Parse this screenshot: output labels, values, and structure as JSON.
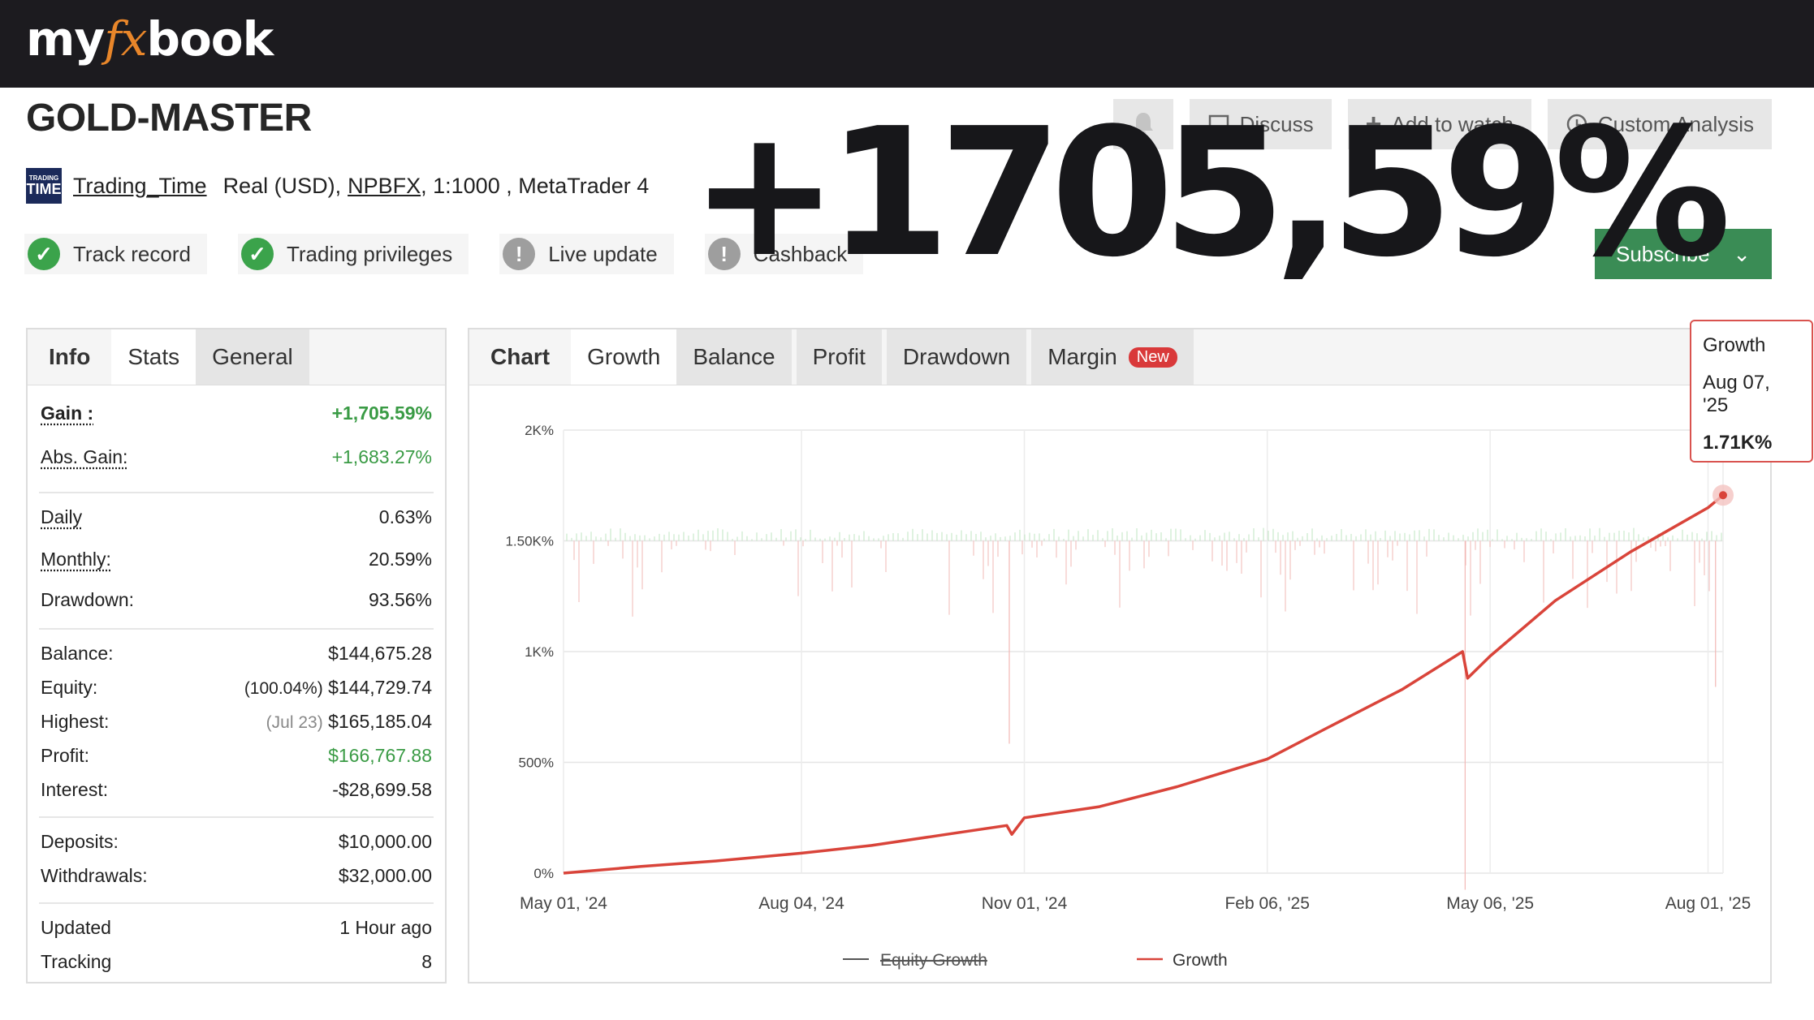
{
  "brand": {
    "logo_pre": "my",
    "logo_fx": "fx",
    "logo_post": "book"
  },
  "system": {
    "title": "GOLD-MASTER",
    "owner_logo_small": "TRADING",
    "owner_logo_big": "TIME",
    "owner": "Trading_Time",
    "account": "Real (USD),",
    "broker": "NPBFX",
    "leverage_platform": ", 1:1000 , MetaTrader 4"
  },
  "badges": [
    {
      "label": "Track record",
      "status": "ok"
    },
    {
      "label": "Trading privileges",
      "status": "ok"
    },
    {
      "label": "Live update",
      "status": "warn"
    },
    {
      "label": "Cashback",
      "status": "warn"
    }
  ],
  "actions": {
    "bell_icon": "bell-icon",
    "discuss": "Discuss",
    "watch": "Add to watch",
    "analysis": "Custom Analysis",
    "subscribe": "Subscribe"
  },
  "headline": "+1705,59%",
  "left_tabs": {
    "header": "Info",
    "stats": "Stats",
    "general": "General"
  },
  "stats": {
    "gain_label": "Gain :",
    "gain": "+1,705.59%",
    "abs_gain_label": "Abs. Gain:",
    "abs_gain": "+1,683.27%",
    "daily_label": "Daily",
    "daily": "0.63%",
    "monthly_label": "Monthly:",
    "monthly": "20.59%",
    "drawdown_label": "Drawdown:",
    "drawdown": "93.56%",
    "balance_label": "Balance:",
    "balance": "$144,675.28",
    "equity_label": "Equity:",
    "equity_pct": "(100.04%)",
    "equity": "$144,729.74",
    "highest_label": "Highest:",
    "highest_date": "(Jul 23)",
    "highest": "$165,185.04",
    "profit_label": "Profit:",
    "profit": "$166,767.88",
    "interest_label": "Interest:",
    "interest": "-$28,699.58",
    "deposits_label": "Deposits:",
    "deposits": "$10,000.00",
    "withdrawals_label": "Withdrawals:",
    "withdrawals": "$32,000.00",
    "updated_label": "Updated",
    "updated": "1 Hour ago",
    "tracking_label": "Tracking",
    "tracking": "8"
  },
  "chart_tabs": {
    "header": "Chart",
    "growth": "Growth",
    "balance": "Balance",
    "profit": "Profit",
    "drawdown": "Drawdown",
    "margin": "Margin",
    "new_badge": "New"
  },
  "tooltip": {
    "series": "Growth",
    "date": "Aug 07, '25",
    "value": "1.71K%"
  },
  "chart_data": {
    "type": "line",
    "x_axis_type": "date",
    "y_ticks": [
      "0%",
      "500%",
      "1K%",
      "1.50K%",
      "2K%"
    ],
    "ylim": [
      0,
      2000
    ],
    "x_ticks": [
      "May 01, '24",
      "Aug 04, '24",
      "Nov 01, '24",
      "Feb 06, '25",
      "May 06, '25",
      "Aug 01, '25"
    ],
    "legend": [
      {
        "name": "Equity Growth",
        "hidden": true,
        "color": "#555555"
      },
      {
        "name": "Growth",
        "hidden": false,
        "color": "#d9443a"
      }
    ],
    "grid": true,
    "series": [
      {
        "name": "Growth",
        "color": "#d9443a",
        "points": [
          [
            "2024-05-01",
            0
          ],
          [
            "2024-06-01",
            30
          ],
          [
            "2024-07-01",
            55
          ],
          [
            "2024-08-04",
            90
          ],
          [
            "2024-09-01",
            125
          ],
          [
            "2024-10-01",
            175
          ],
          [
            "2024-10-25",
            215
          ],
          [
            "2024-10-27",
            175
          ],
          [
            "2024-11-01",
            250
          ],
          [
            "2024-12-01",
            300
          ],
          [
            "2025-01-01",
            390
          ],
          [
            "2025-02-06",
            515
          ],
          [
            "2025-03-01",
            650
          ],
          [
            "2025-04-01",
            830
          ],
          [
            "2025-04-25",
            1000
          ],
          [
            "2025-04-27",
            880
          ],
          [
            "2025-05-06",
            980
          ],
          [
            "2025-06-01",
            1230
          ],
          [
            "2025-07-01",
            1450
          ],
          [
            "2025-08-01",
            1650
          ],
          [
            "2025-08-07",
            1706
          ]
        ]
      }
    ]
  }
}
